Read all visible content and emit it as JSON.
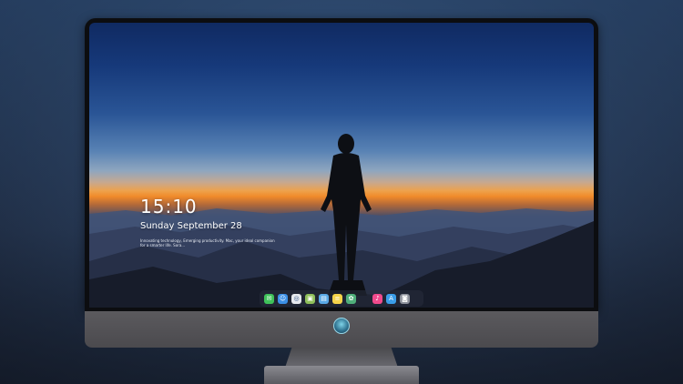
{
  "lockscreen": {
    "time": "15:10",
    "date": "Sunday September 28",
    "tagline": "Innovating technology, Emerging productivity. Mac, your ideal companion for a smarter life. Sora..."
  },
  "dock": {
    "items": [
      {
        "name": "messages-icon",
        "glyph": "✉",
        "color": "#3fc25a"
      },
      {
        "name": "finder-icon",
        "glyph": "☺",
        "color": "#3b8fe6"
      },
      {
        "name": "safari-icon",
        "glyph": "◎",
        "color": "#e6e9ee"
      },
      {
        "name": "preview-icon",
        "glyph": "▣",
        "color": "#8fbf5a"
      },
      {
        "name": "clapper-icon",
        "glyph": "▤",
        "color": "#5aa9e6"
      },
      {
        "name": "notes-icon",
        "glyph": "≡",
        "color": "#f6d44a"
      },
      {
        "name": "photos-icon",
        "glyph": "✿",
        "color": "#4fae7a"
      },
      {
        "name": "music-icon",
        "glyph": "♪",
        "color": "#f04a8c"
      },
      {
        "name": "app-store-icon",
        "glyph": "A",
        "color": "#3a9de8"
      },
      {
        "name": "camera-icon",
        "glyph": "◙",
        "color": "#8d919b"
      }
    ]
  }
}
